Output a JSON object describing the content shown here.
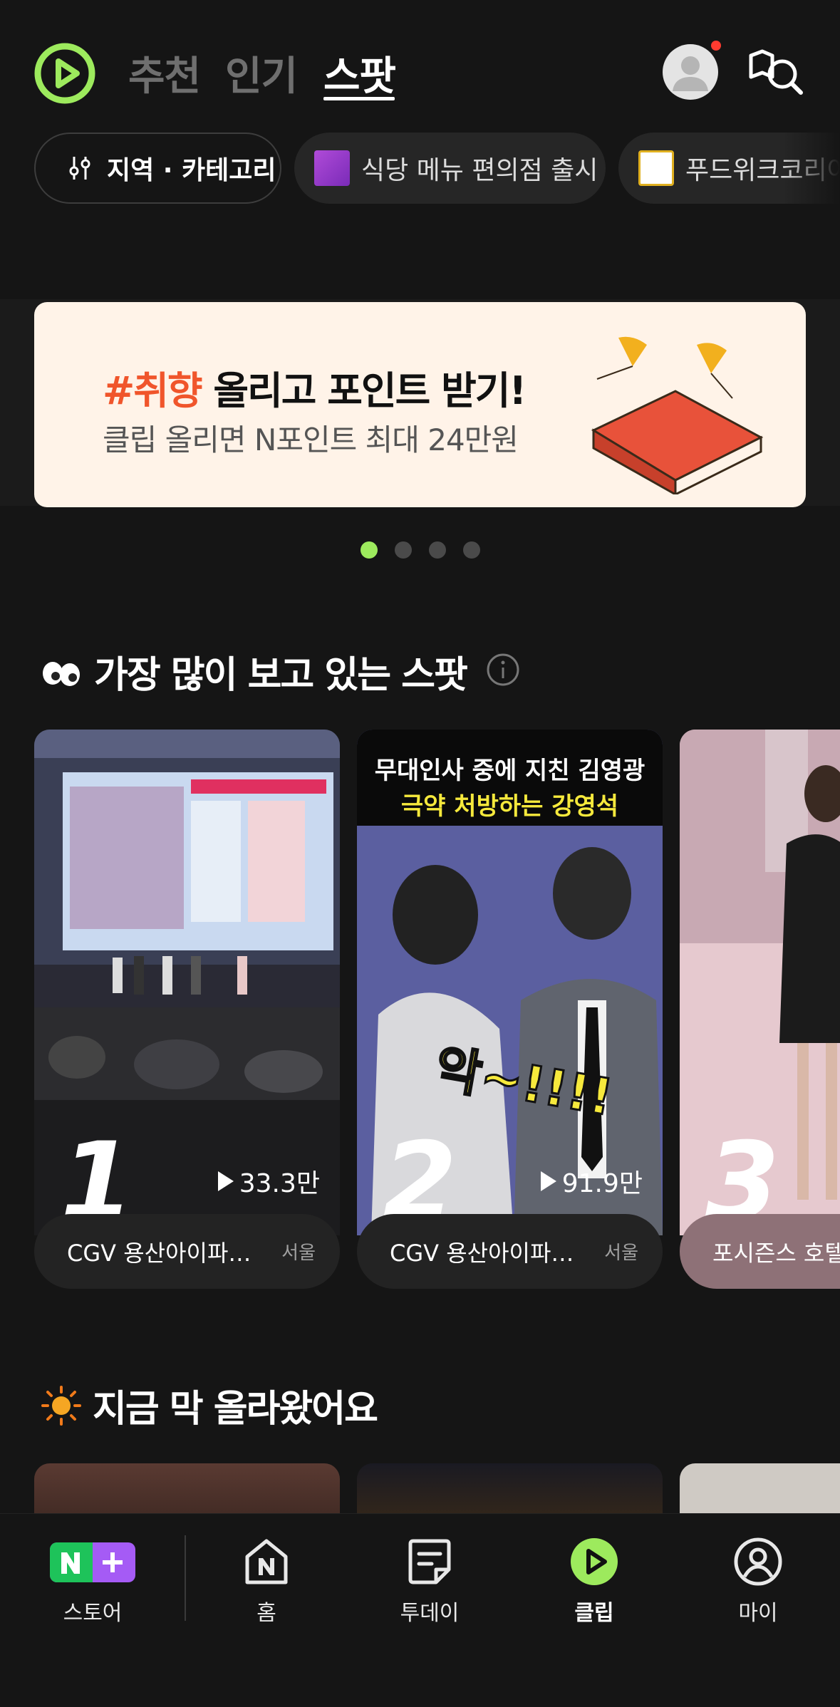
{
  "header": {
    "tabs": [
      {
        "label": "추천",
        "active": false
      },
      {
        "label": "인기",
        "active": false
      },
      {
        "label": "스팟",
        "active": true
      }
    ],
    "brand_color": "#9dea5d",
    "notification_color": "#ff3b30"
  },
  "chips": [
    {
      "label": "지역 · 카테고리",
      "icon": "filter-icon"
    },
    {
      "label": "식당 메뉴 편의점 출시"
    },
    {
      "label": "푸드위크코리아"
    }
  ],
  "banner": {
    "title_highlight": "#취향",
    "title_rest": " 올리고 포인트 받기!",
    "subtitle": "클립 올리면 N포인트 최대 24만원",
    "highlight_color": "#f0552b",
    "page_count": 4,
    "active_page": 1
  },
  "most_viewed": {
    "title": "가장 많이 보고 있는 스팟",
    "cards": [
      {
        "rank": "1",
        "views": "33.3만",
        "place": "CGV 용산아이파…",
        "region": "서울"
      },
      {
        "rank": "2",
        "views": "91.9만",
        "place": "CGV 용산아이파…",
        "region": "서울",
        "caption_top": "무대인사 중에 지친 김영광",
        "caption_bottom": "극약 처방하는 강영석",
        "overlay": "악~!!!!"
      },
      {
        "rank": "3",
        "views": "",
        "place": "포시즌스 호텔",
        "region": ""
      }
    ]
  },
  "just_uploaded": {
    "title": "지금 막 올라왔어요"
  },
  "bottom_nav": [
    {
      "label": "스토어",
      "icon": "naver-plus-store-icon",
      "active": false
    },
    {
      "label": "홈",
      "icon": "home-n-icon",
      "active": false
    },
    {
      "label": "투데이",
      "icon": "today-icon",
      "active": false
    },
    {
      "label": "클립",
      "icon": "clip-play-icon",
      "active": true
    },
    {
      "label": "마이",
      "icon": "profile-icon",
      "active": false
    }
  ]
}
